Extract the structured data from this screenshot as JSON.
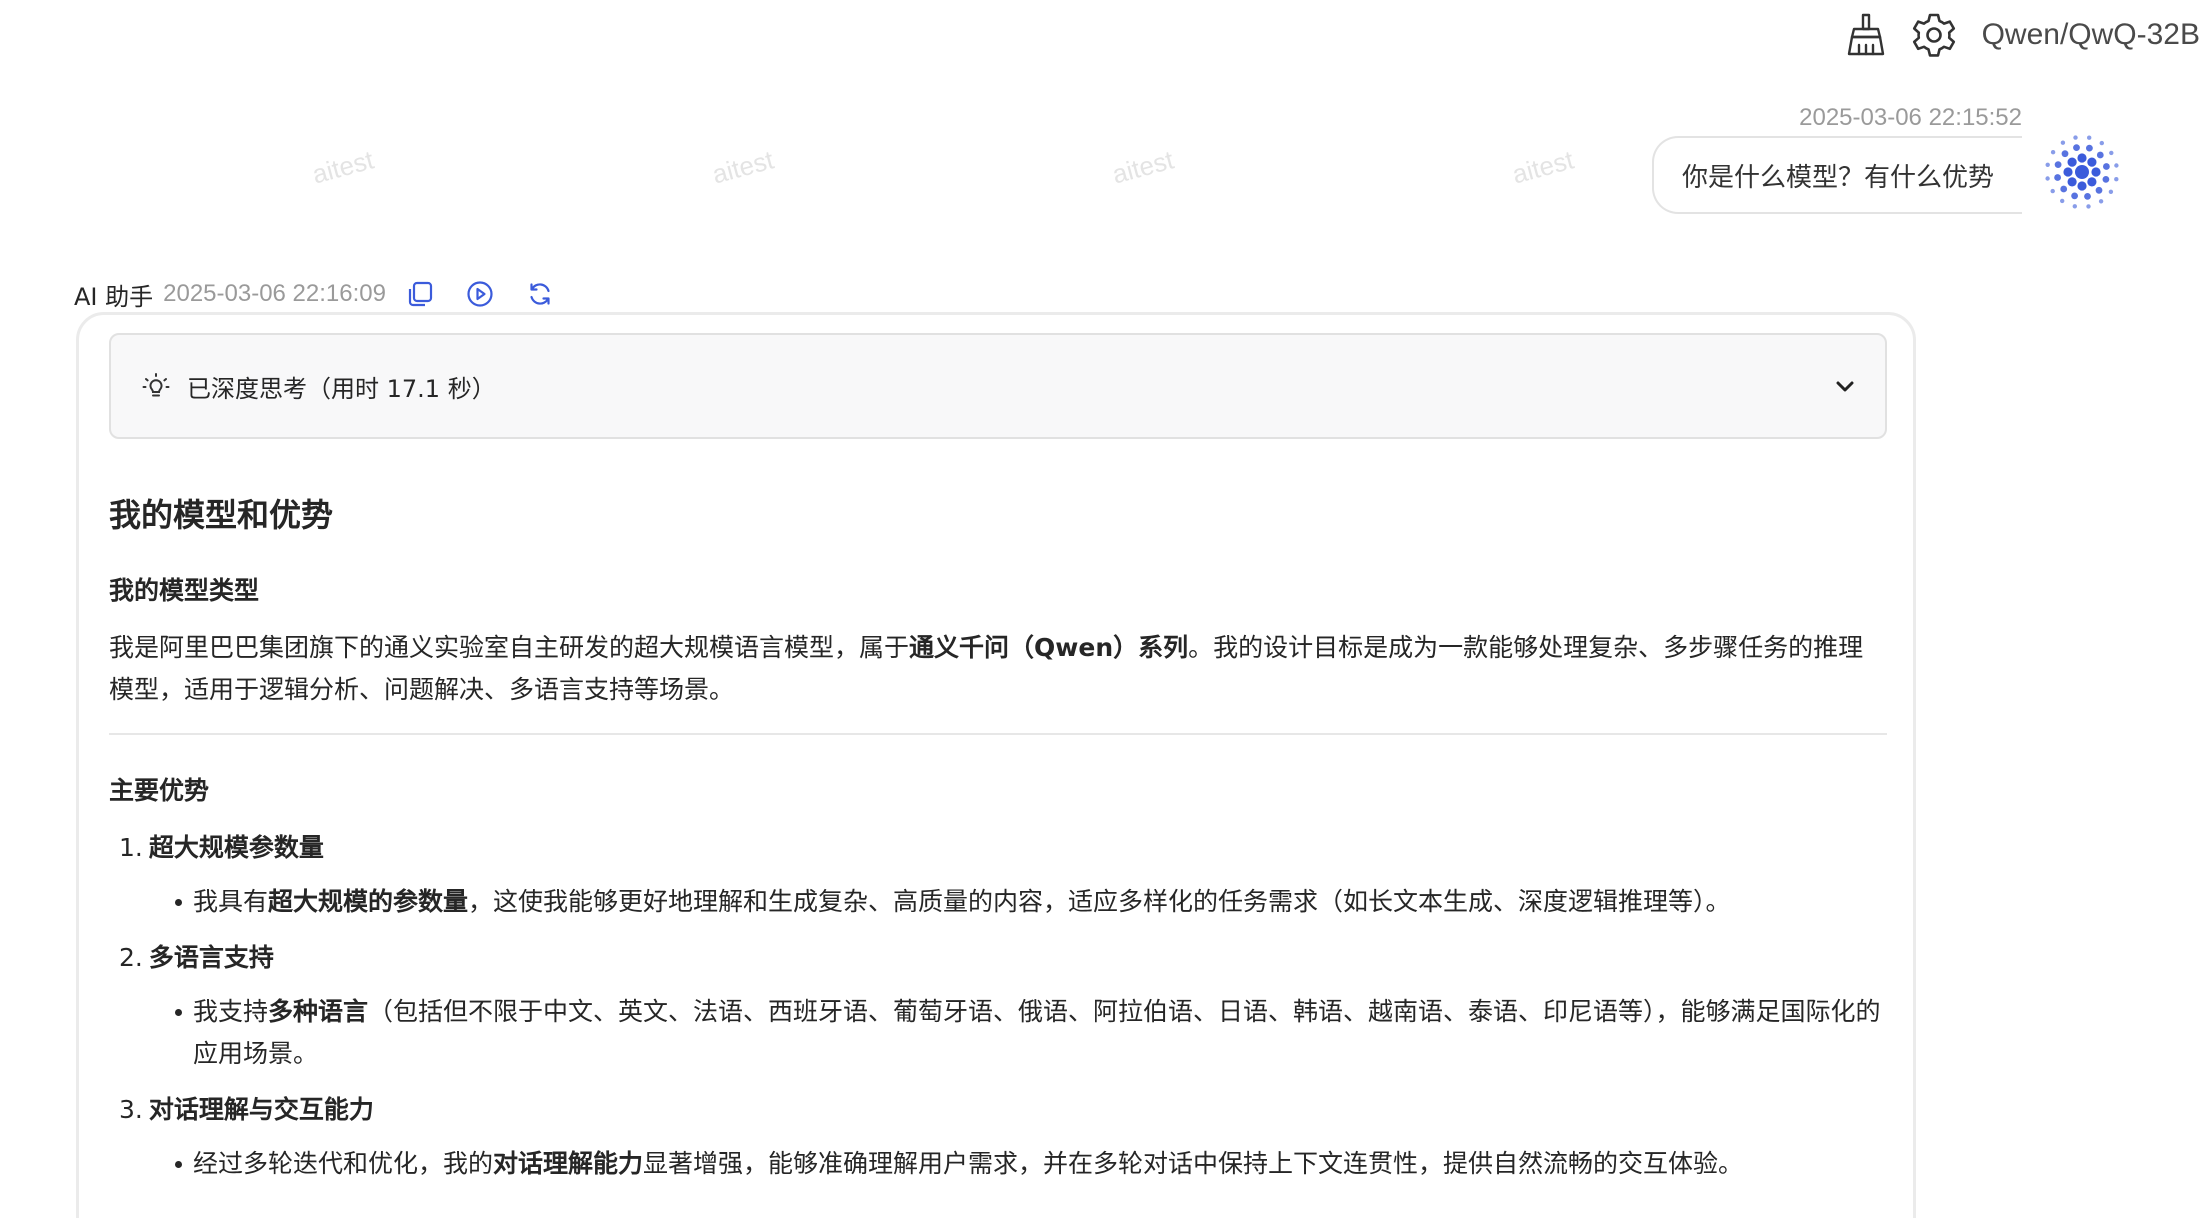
{
  "header": {
    "model_name": "Qwen/QwQ-32B",
    "clear_icon": "broom-icon",
    "settings_icon": "gear-icon"
  },
  "user_message": {
    "timestamp": "2025-03-06 22:15:52",
    "text": "你是什么模型？有什么优势"
  },
  "assistant": {
    "name": "AI 助手",
    "timestamp": "2025-03-06 22:16:09",
    "actions": [
      "copy-icon",
      "play-icon",
      "refresh-icon"
    ],
    "thinking_label": "已深度思考（用时 17.1 秒）",
    "content": {
      "heading": "我的模型和优势",
      "section1_title": "我的模型类型",
      "section1_text_a": "我是阿里巴巴集团旗下的通义实验室自主研发的超大规模语言模型，属于",
      "section1_text_bold": "通义千问（Qwen）系列",
      "section1_text_b": "。我的设计目标是成为一款能够处理复杂、多步骤任务的推理模型，适用于逻辑分析、问题解决、多语言支持等场景。",
      "section2_title": "主要优势",
      "items": [
        {
          "num": "1.",
          "title": "超大规模参数量",
          "pre": "我具有",
          "bold": "超大规模的参数量",
          "post": "，这使我能够更好地理解和生成复杂、高质量的内容，适应多样化的任务需求（如长文本生成、深度逻辑推理等）。"
        },
        {
          "num": "2.",
          "title": "多语言支持",
          "pre": "我支持",
          "bold": "多种语言",
          "post": "（包括但不限于中文、英文、法语、西班牙语、葡萄牙语、俄语、阿拉伯语、日语、韩语、越南语、泰语、印尼语等），能够满足国际化的应用场景。"
        },
        {
          "num": "3.",
          "title": "对话理解与交互能力",
          "pre": "经过多轮迭代和优化，我的",
          "bold": "对话理解能力",
          "post": "显著增强，能够准确理解用户需求，并在多轮对话中保持上下文连贯性，提供自然流畅的交互体验。"
        }
      ]
    }
  },
  "watermark": "aitest",
  "colors": {
    "accent": "#3b5bdb",
    "muted_text": "#9a9a9a",
    "border": "#e3e3e3"
  }
}
